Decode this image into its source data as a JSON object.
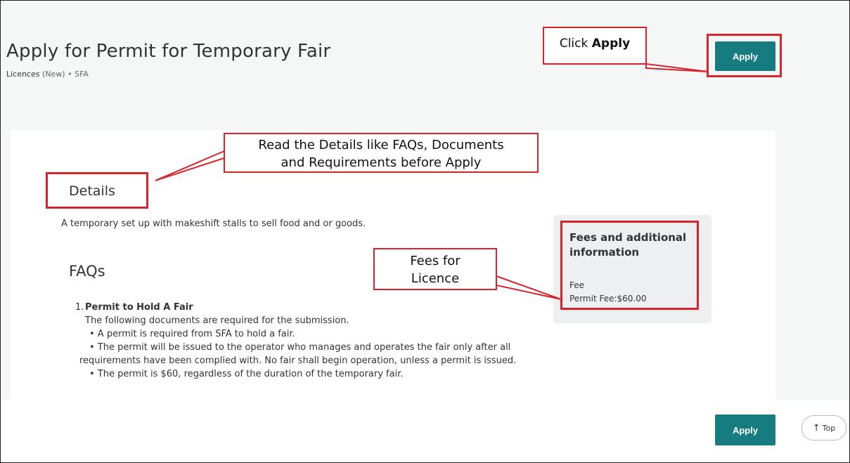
{
  "page": {
    "title": "Apply for Permit for Temporary Fair",
    "subtitle_category": "Licences",
    "subtitle_rest": " (New) • SFA",
    "apply_label": "Apply"
  },
  "details": {
    "heading": "Details",
    "text": "A temporary set up with makeshift stalls to sell food and or goods."
  },
  "faqs": {
    "heading": "FAQs",
    "item_number": "1.",
    "question": "Permit to Hold A Fair",
    "lines": [
      "The following documents are required for the submission.",
      "•  A permit is required from SFA to hold a fair.",
      "•  The permit will be issued to the operator who manages and operates the fair only after all requirements have been complied with. No fair shall begin operation, unless a permit is issued.",
      "•  The permit is $60, regardless of the duration of the temporary fair."
    ]
  },
  "fees": {
    "title": "Fees and additional information",
    "label": "Fee",
    "value": "Permit Fee:$60.00"
  },
  "footer": {
    "apply_label": "Apply",
    "top_label": "Top",
    "top_arrow": "↑"
  },
  "callouts": {
    "click_prefix": "Click ",
    "click_bold": "Apply",
    "read_line1": "Read the Details like FAQs, Documents",
    "read_line2": "and Requirements before Apply",
    "fees_line1": "Fees for",
    "fees_line2": "Licence"
  },
  "colors": {
    "accent": "#167c80",
    "annotation": "#d6242c"
  }
}
